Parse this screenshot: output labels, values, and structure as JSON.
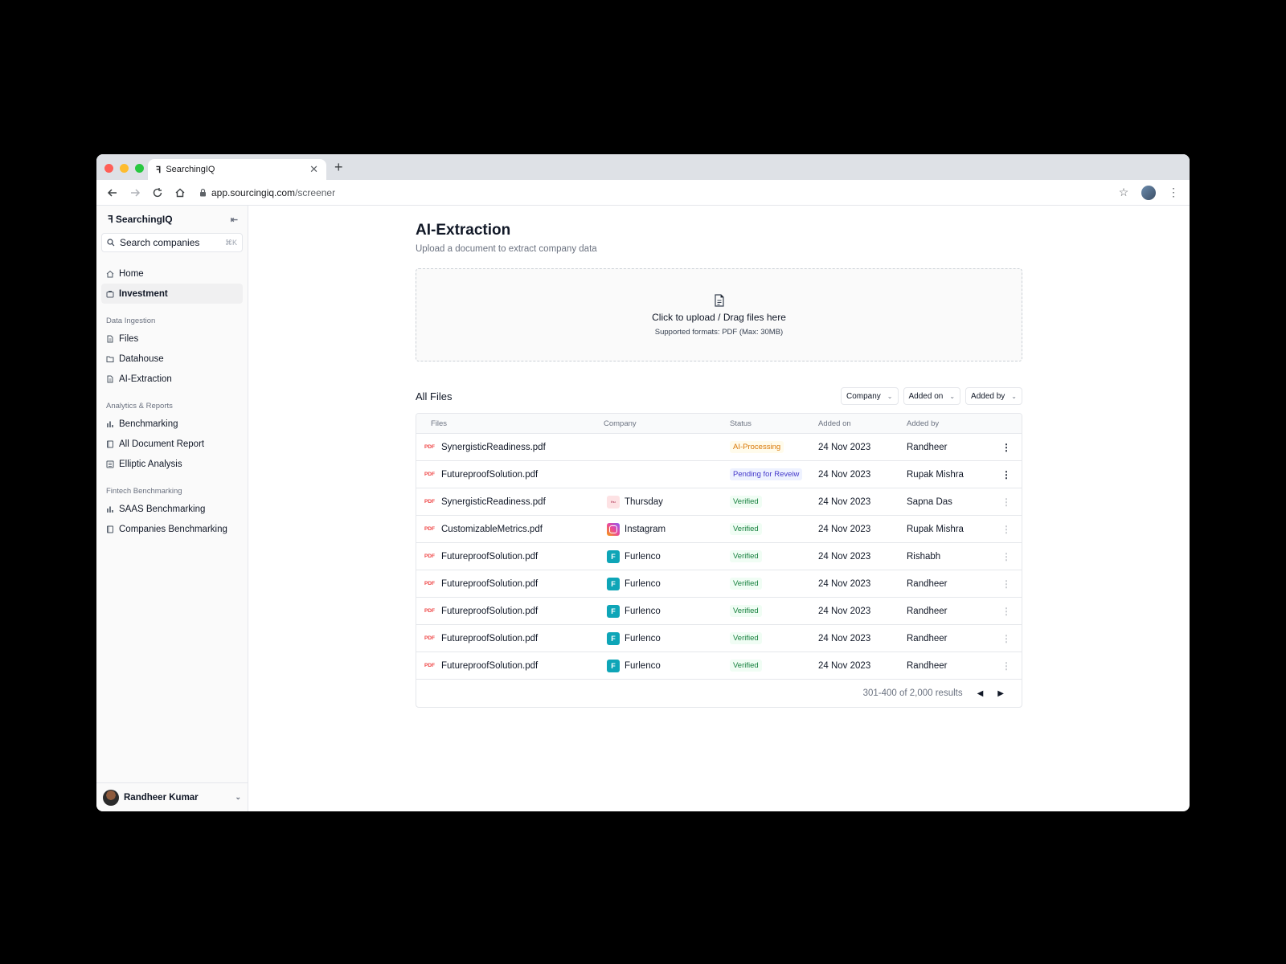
{
  "browser": {
    "tab_title": "SearchingIQ",
    "url_host": "app.sourcingiq.com",
    "url_path": "/screener",
    "traffic_colors": [
      "#ff5f57",
      "#febc2e",
      "#28c840"
    ]
  },
  "sidebar": {
    "brand": "SearchingIQ",
    "search_placeholder": "Search companies",
    "search_shortcut": "⌘K",
    "top_items": [
      {
        "label": "Home",
        "icon": "home-icon"
      },
      {
        "label": "Investment",
        "icon": "briefcase-icon",
        "active": true
      }
    ],
    "sections": [
      {
        "label": "Data Ingestion",
        "items": [
          {
            "label": "Files",
            "icon": "file-icon"
          },
          {
            "label": "Datahouse",
            "icon": "folder-icon"
          },
          {
            "label": "AI-Extraction",
            "icon": "file-icon"
          }
        ]
      },
      {
        "label": "Analytics & Reports",
        "items": [
          {
            "label": "Benchmarking",
            "icon": "bar-chart-icon"
          },
          {
            "label": "All Document Report",
            "icon": "book-icon"
          },
          {
            "label": "Elliptic Analysis",
            "icon": "list-icon"
          }
        ]
      },
      {
        "label": "Fintech Benchmarking",
        "items": [
          {
            "label": "SAAS Benchmarking",
            "icon": "bar-chart-icon"
          },
          {
            "label": "Companies Benchmarking",
            "icon": "book-icon"
          }
        ]
      }
    ],
    "user_name": "Randheer Kumar"
  },
  "main": {
    "title": "AI-Extraction",
    "subtitle": "Upload a document to extract company data",
    "upload_primary": "Click to upload / Drag files here",
    "upload_secondary": "Supported formats: PDF (Max: 30MB)",
    "files_heading": "All Files",
    "filters": [
      "Company",
      "Added on",
      "Added by"
    ],
    "columns": [
      "Files",
      "Company",
      "Status",
      "Added on",
      "Added by"
    ],
    "rows": [
      {
        "file": "SynergisticReadiness.pdf",
        "company": "",
        "logo": "",
        "status": "AI-Processing",
        "status_kind": "processing",
        "added_on": "24 Nov 2023",
        "added_by": "Randheer",
        "menu_active": true
      },
      {
        "file": "FutureproofSolution.pdf",
        "company": "",
        "logo": "",
        "status": "Pending for Reveiw",
        "status_kind": "pending",
        "added_on": "24 Nov 2023",
        "added_by": "Rupak Mishra",
        "menu_active": true
      },
      {
        "file": "SynergisticReadiness.pdf",
        "company": "Thursday",
        "logo": "thursday",
        "status": "Verified",
        "status_kind": "verified",
        "added_on": "24 Nov 2023",
        "added_by": "Sapna Das",
        "menu_active": false
      },
      {
        "file": "CustomizableMetrics.pdf",
        "company": "Instagram",
        "logo": "instagram",
        "status": "Verified",
        "status_kind": "verified",
        "added_on": "24 Nov 2023",
        "added_by": "Rupak Mishra",
        "menu_active": false
      },
      {
        "file": "FutureproofSolution.pdf",
        "company": "Furlenco",
        "logo": "furlenco",
        "status": "Verified",
        "status_kind": "verified",
        "added_on": "24 Nov 2023",
        "added_by": "Rishabh",
        "menu_active": false
      },
      {
        "file": "FutureproofSolution.pdf",
        "company": "Furlenco",
        "logo": "furlenco",
        "status": "Verified",
        "status_kind": "verified",
        "added_on": "24 Nov 2023",
        "added_by": "Randheer",
        "menu_active": false
      },
      {
        "file": "FutureproofSolution.pdf",
        "company": "Furlenco",
        "logo": "furlenco",
        "status": "Verified",
        "status_kind": "verified",
        "added_on": "24 Nov 2023",
        "added_by": "Randheer",
        "menu_active": false
      },
      {
        "file": "FutureproofSolution.pdf",
        "company": "Furlenco",
        "logo": "furlenco",
        "status": "Verified",
        "status_kind": "verified",
        "added_on": "24 Nov 2023",
        "added_by": "Randheer",
        "menu_active": false
      },
      {
        "file": "FutureproofSolution.pdf",
        "company": "Furlenco",
        "logo": "furlenco",
        "status": "Verified",
        "status_kind": "verified",
        "added_on": "24 Nov 2023",
        "added_by": "Randheer",
        "menu_active": false
      }
    ],
    "pagination": "301-400 of 2,000 results",
    "pdf_tag": "PDF"
  }
}
